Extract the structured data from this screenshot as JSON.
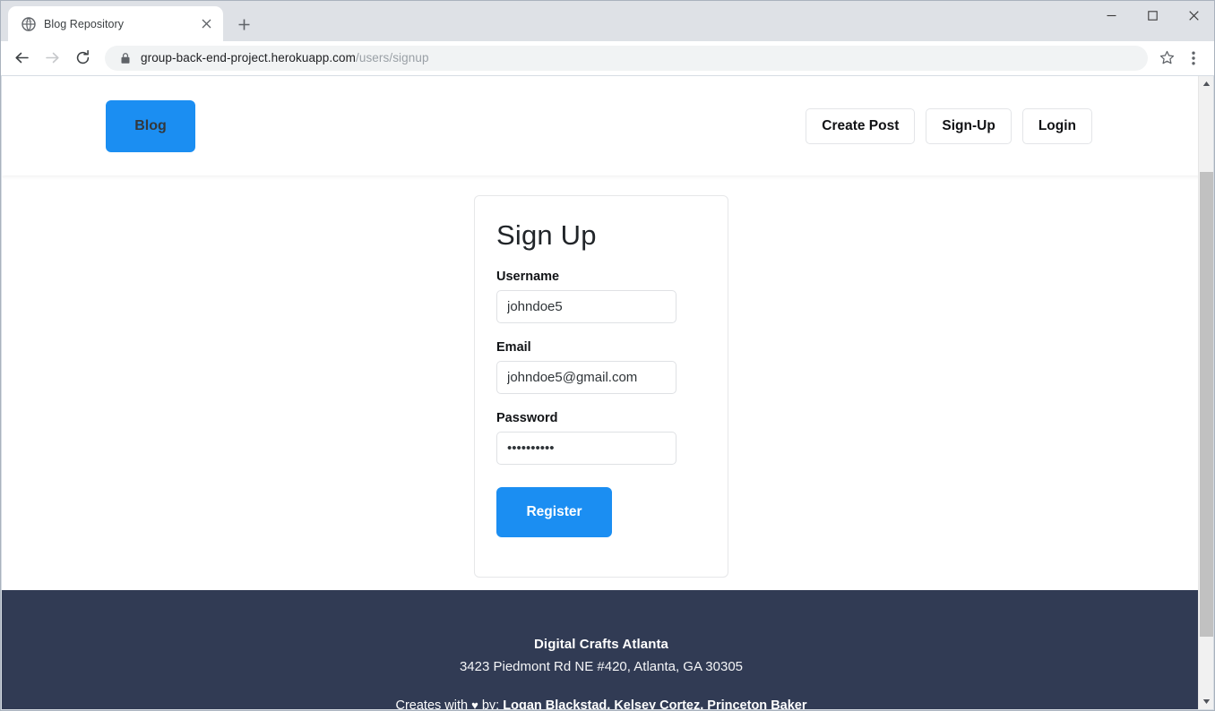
{
  "browser": {
    "tab": {
      "title": "Blog Repository",
      "favicon": "globe-icon",
      "close_label": "×"
    },
    "new_tab_label": "+",
    "window_controls": {
      "minimize": "–",
      "maximize": "□",
      "close": "✕"
    },
    "toolbar": {
      "back": "back-arrow-icon",
      "forward": "forward-arrow-icon",
      "reload": "reload-icon",
      "lock": "lock-icon",
      "url_domain": "group-back-end-project.herokuapp.com",
      "url_path": "/users/signup",
      "bookmark": "star-icon",
      "menu": "three-dot-menu-icon"
    }
  },
  "page": {
    "header": {
      "brand_label": "Blog",
      "nav": [
        {
          "label": "Create Post"
        },
        {
          "label": "Sign-Up"
        },
        {
          "label": "Login"
        }
      ]
    },
    "signup": {
      "title": "Sign Up",
      "fields": [
        {
          "label": "Username",
          "value": "johndoe5",
          "type": "text"
        },
        {
          "label": "Email",
          "value": "johndoe5@gmail.com",
          "type": "text"
        },
        {
          "label": "Password",
          "value": "••••••••••",
          "type": "password"
        }
      ],
      "submit_label": "Register"
    },
    "footer": {
      "org": "Digital Crafts Atlanta",
      "address": "3423 Piedmont Rd NE #420, Atlanta, GA 30305",
      "credits_prefix": "Creates with ",
      "credits_heart": "♥",
      "credits_by": " by: ",
      "credits_names": "Logan Blackstad, Kelsey Cortez, Princeton Baker"
    }
  },
  "colors": {
    "accent_blue": "#1b8ef2",
    "footer_navy": "#313b54",
    "tabstrip": "#dee1e6"
  }
}
